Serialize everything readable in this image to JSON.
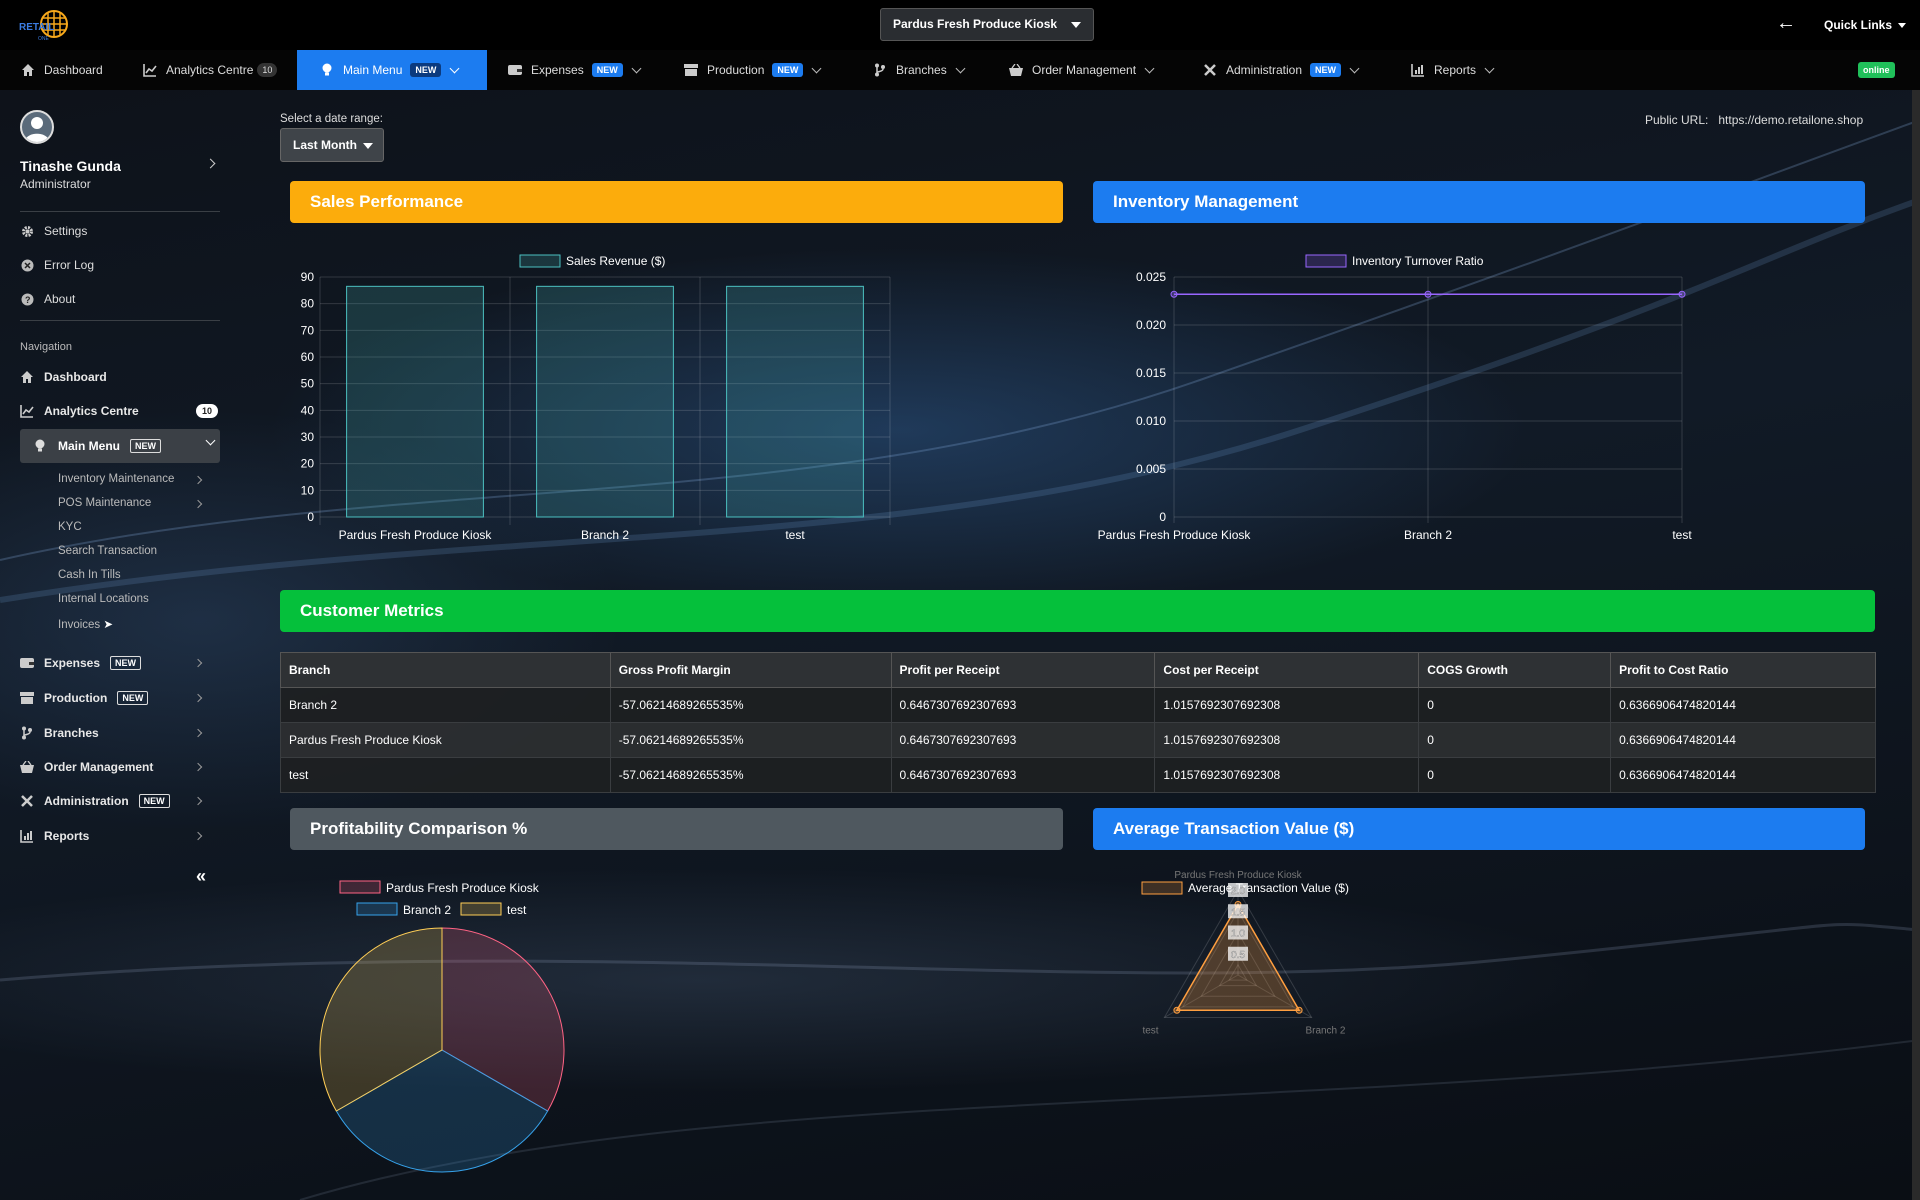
{
  "topbar": {
    "branch_selector": "Pardus Fresh Produce Kiosk",
    "quick_links": "Quick Links"
  },
  "nav": {
    "items": [
      {
        "label": "Dashboard"
      },
      {
        "label": "Analytics Centre",
        "count": "10"
      },
      {
        "label": "Main Menu",
        "badge": "NEW"
      },
      {
        "label": "Expenses",
        "badge": "NEW"
      },
      {
        "label": "Production",
        "badge": "NEW"
      },
      {
        "label": "Branches"
      },
      {
        "label": "Order Management"
      },
      {
        "label": "Administration",
        "badge": "NEW"
      },
      {
        "label": "Reports"
      }
    ],
    "status": "online"
  },
  "sidebar": {
    "user_name": "Tinashe Gunda",
    "user_role": "Administrator",
    "top_links": [
      "Settings",
      "Error Log",
      "About"
    ],
    "section_title": "Navigation",
    "dashboard": "Dashboard",
    "analytics": "Analytics Centre",
    "analytics_count": "10",
    "main_menu": "Main Menu",
    "new_badge": "NEW",
    "sub_items": [
      "Inventory Maintenance",
      "POS Maintenance",
      "KYC",
      "Search Transaction",
      "Cash In Tills",
      "Internal Locations",
      "Invoices"
    ],
    "expenses": "Expenses",
    "production": "Production",
    "branches": "Branches",
    "order_management": "Order Management",
    "administration": "Administration",
    "reports": "Reports",
    "collapse": "«"
  },
  "filters": {
    "date_label": "Select a date range:",
    "date_value": "Last Month",
    "public_url_label": "Public URL:",
    "public_url": "https://demo.retailone.shop"
  },
  "panels": {
    "sales": "Sales Performance",
    "inventory": "Inventory Management",
    "customer": "Customer Metrics",
    "profitability": "Profitability Comparison %",
    "avg_tx": "Average Transaction Value ($)"
  },
  "colors": {
    "sales_header": "#fcac0c",
    "inventory_header": "#1c7cf0",
    "customer_header": "#05c03b",
    "profitability_header": "#4f585f",
    "avg_header": "#1c7cf0"
  },
  "table": {
    "headers": [
      "Branch",
      "Gross Profit Margin",
      "Profit per Receipt",
      "Cost per Receipt",
      "COGS Growth",
      "Profit to Cost Ratio"
    ],
    "rows": [
      [
        "Branch 2",
        "-57.06214689265535%",
        "0.6467307692307693",
        "1.0157692307692308",
        "0",
        "0.6366906474820144"
      ],
      [
        "Pardus Fresh Produce Kiosk",
        "-57.06214689265535%",
        "0.6467307692307693",
        "1.0157692307692308",
        "0",
        "0.6366906474820144"
      ],
      [
        "test",
        "-57.06214689265535%",
        "0.6467307692307693",
        "1.0157692307692308",
        "0",
        "0.6366906474820144"
      ]
    ]
  },
  "chart_data": [
    {
      "type": "bar",
      "categories": [
        "Pardus Fresh Produce Kiosk",
        "Branch 2",
        "test"
      ],
      "series": [
        {
          "name": "Sales Revenue ($)",
          "values": [
            86.5,
            86.5,
            86.5
          ]
        }
      ],
      "ylim": [
        0,
        90
      ],
      "yticks": [
        0,
        10,
        20,
        30,
        40,
        50,
        60,
        70,
        80,
        90
      ],
      "color": "#4bc0c0",
      "legend": "top"
    },
    {
      "type": "line",
      "categories": [
        "Pardus Fresh Produce Kiosk",
        "Branch 2",
        "test"
      ],
      "series": [
        {
          "name": "Inventory Turnover Ratio",
          "values": [
            0.0232,
            0.0232,
            0.0232
          ]
        }
      ],
      "ylim": [
        0,
        0.025
      ],
      "yticks": [
        "0",
        "0.005",
        "0.010",
        "0.015",
        "0.020",
        "0.025"
      ],
      "color": "#9966ff",
      "legend": "top"
    },
    {
      "type": "pie",
      "labels": [
        "Pardus Fresh Produce Kiosk",
        "Branch 2",
        "test"
      ],
      "values": [
        33.3,
        33.3,
        33.3
      ],
      "colors": [
        "#ff6384",
        "#36a2eb",
        "#ffce56"
      ],
      "legend": "top"
    },
    {
      "type": "radar",
      "labels": [
        "Pardus Fresh Produce Kiosk",
        "Branch 2",
        "test"
      ],
      "series": [
        {
          "name": "Average Transaction Value ($)",
          "values": [
            1.66,
            1.66,
            1.66
          ]
        }
      ],
      "rlim": [
        0,
        2.0
      ],
      "rticks": [
        "0.5",
        "1.0",
        "1.5",
        "2.0"
      ],
      "color": "#ff9f40",
      "legend": "top"
    }
  ]
}
